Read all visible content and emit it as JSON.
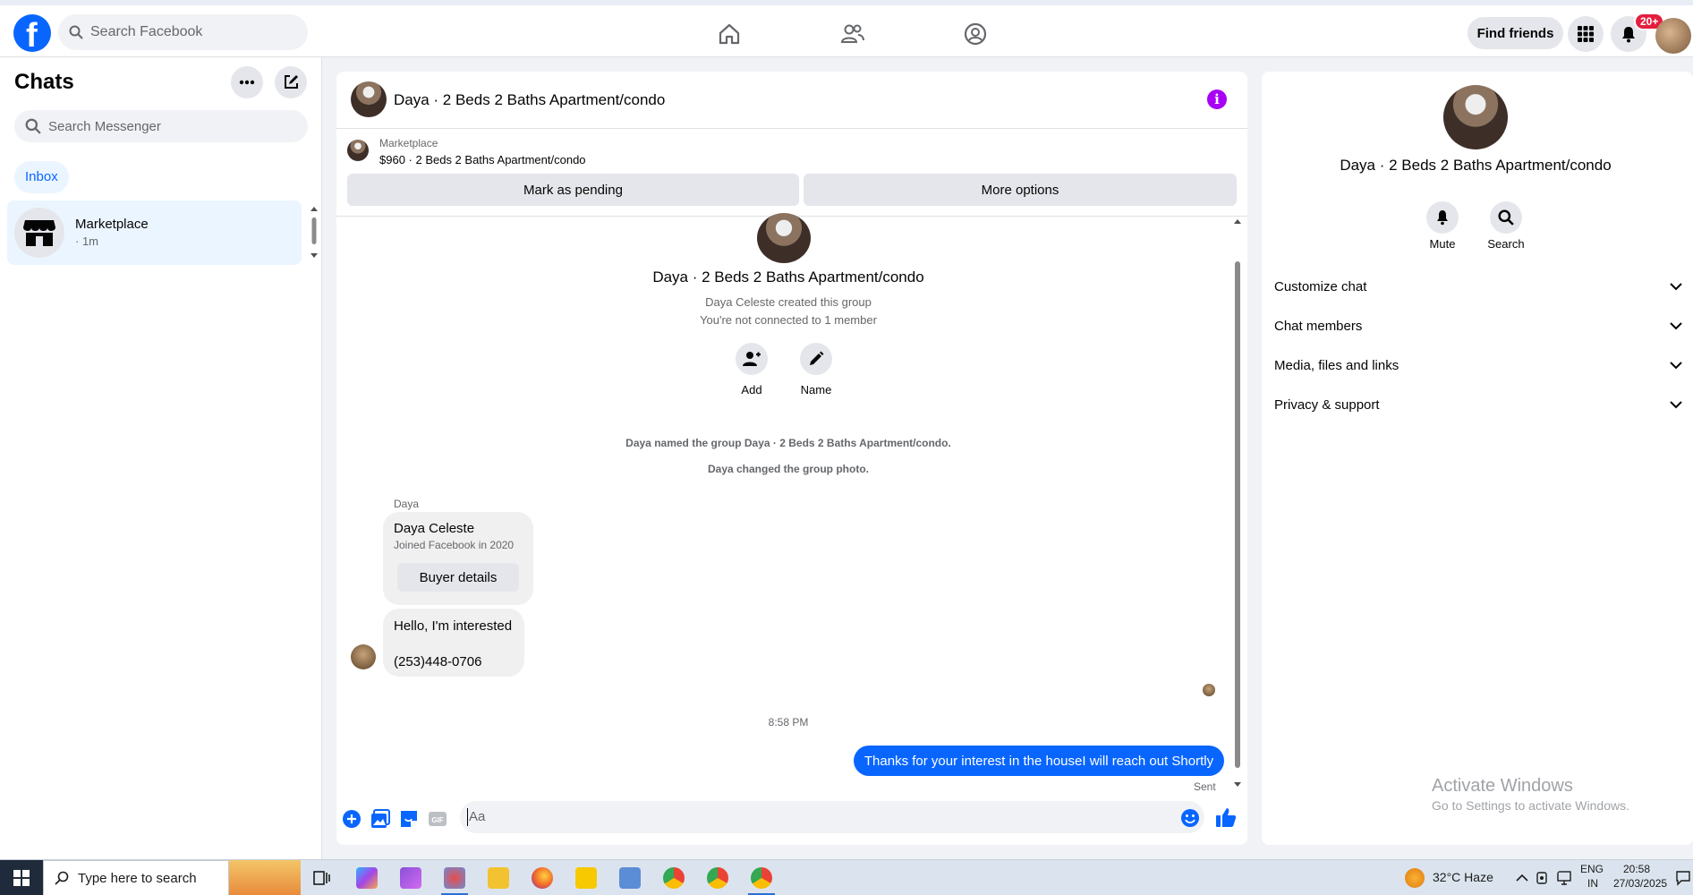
{
  "topbar": {
    "search_placeholder": "Search Facebook",
    "find_friends": "Find friends",
    "notification_count": "20+"
  },
  "left": {
    "title": "Chats",
    "search_placeholder": "Search Messenger",
    "inbox": "Inbox",
    "chat_items": [
      {
        "name": "Marketplace",
        "time": "· 1m"
      }
    ]
  },
  "conversation": {
    "title": "Daya · 2 Beds 2 Baths Apartment/condo",
    "marketplace_label": "Marketplace",
    "listing": "$960 · 2 Beds 2 Baths Apartment/condo",
    "mark_pending": "Mark as pending",
    "more_options": "More options",
    "group_title": "Daya · 2 Beds 2 Baths Apartment/condo",
    "created": "Daya Celeste created this group",
    "not_connected": "You're not connected to 1 member",
    "add_label": "Add",
    "name_label": "Name",
    "event_named": "Daya named the group Daya · 2 Beds 2 Baths Apartment/condo.",
    "event_photo": "Daya changed the group photo.",
    "sender": "Daya",
    "buyer_name": "Daya Celeste",
    "buyer_joined": "Joined Facebook in 2020",
    "buyer_details": "Buyer details",
    "msg_line1": "Hello, I'm interested",
    "msg_line2": "(253)448-0706",
    "timestamp": "8:58 PM",
    "sent_msg": "Thanks for your interest in the houseI will reach out Shortly",
    "sent_status": "Sent",
    "composer_placeholder": "Aa"
  },
  "details": {
    "title": "Daya · 2 Beds 2 Baths Apartment/condo",
    "mute": "Mute",
    "search": "Search",
    "sections": [
      "Customize chat",
      "Chat members",
      "Media, files and links",
      "Privacy & support"
    ],
    "activate_title": "Activate Windows",
    "activate_sub": "Go to Settings to activate Windows."
  },
  "taskbar": {
    "search_placeholder": "Type here to search",
    "weather": "32°C  Haze",
    "lang1": "ENG",
    "lang2": "IN",
    "time": "20:58",
    "date": "27/03/2025"
  },
  "colors": {
    "brand_blue": "#0866ff",
    "info_purple": "#a700f5",
    "badge_red": "#e41e3f"
  }
}
